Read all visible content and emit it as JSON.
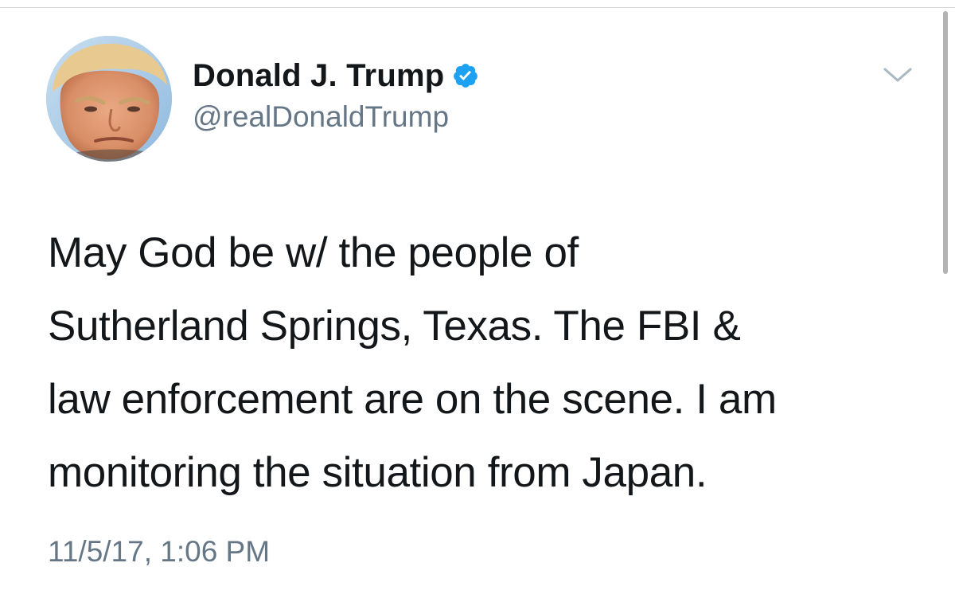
{
  "tweet": {
    "display_name": "Donald J. Trump",
    "handle": "@realDonaldTrump",
    "verified": true,
    "text_lines": [
      "May God be w/ the people of",
      "Sutherland Springs, Texas. The FBI &",
      "law enforcement are on the scene. I am",
      "monitoring the situation from Japan."
    ],
    "timestamp": "11/5/17, 1:06 PM"
  },
  "icons": {
    "verified": "verified-badge-icon",
    "more": "chevron-down-icon",
    "avatar": "profile-photo"
  },
  "colors": {
    "verified_blue": "#1da1f2",
    "secondary_text": "#657786",
    "primary_text": "#14171a",
    "chevron": "#aab8c2"
  }
}
